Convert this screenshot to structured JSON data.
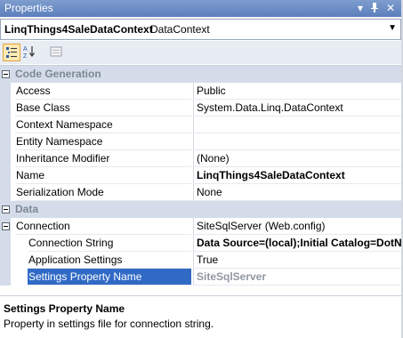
{
  "window": {
    "title": "Properties",
    "buttons": [
      "▾",
      "ᵖ",
      "✕"
    ]
  },
  "object_selector": {
    "name": "LinqThings4SaleDataContext",
    "type": "DataContext"
  },
  "toolbar": {
    "buttons": [
      {
        "icon": "categorized-icon",
        "active": true
      },
      {
        "icon": "alphabetical-sort-icon",
        "active": false
      },
      {
        "icon": "property-pages-icon",
        "active": false
      }
    ]
  },
  "categories": [
    {
      "label": "Code Generation",
      "properties": [
        {
          "name": "Access",
          "value": "Public"
        },
        {
          "name": "Base Class",
          "value": "System.Data.Linq.DataContext"
        },
        {
          "name": "Context Namespace",
          "value": ""
        },
        {
          "name": "Entity Namespace",
          "value": ""
        },
        {
          "name": "Inheritance Modifier",
          "value": "(None)"
        },
        {
          "name": "Name",
          "value": "LinqThings4SaleDataContext"
        },
        {
          "name": "Serialization Mode",
          "value": "None"
        }
      ]
    },
    {
      "label": "Data",
      "properties": [
        {
          "name": "Connection",
          "value": "SiteSqlServer (Web.config)"
        },
        {
          "name": "Connection String",
          "value": "Data Source=(local);Initial Catalog=DotNetNuke"
        },
        {
          "name": "Application Settings",
          "value": "True"
        },
        {
          "name": "Settings Property Name",
          "value": "SiteSqlServer"
        }
      ]
    }
  ],
  "description": {
    "title": "Settings Property Name",
    "text": "Property in settings file for connection string."
  },
  "colors": {
    "title_bar": "#6b8cc7",
    "category_bg": "#d4dcea",
    "selection": "#316ac5"
  }
}
